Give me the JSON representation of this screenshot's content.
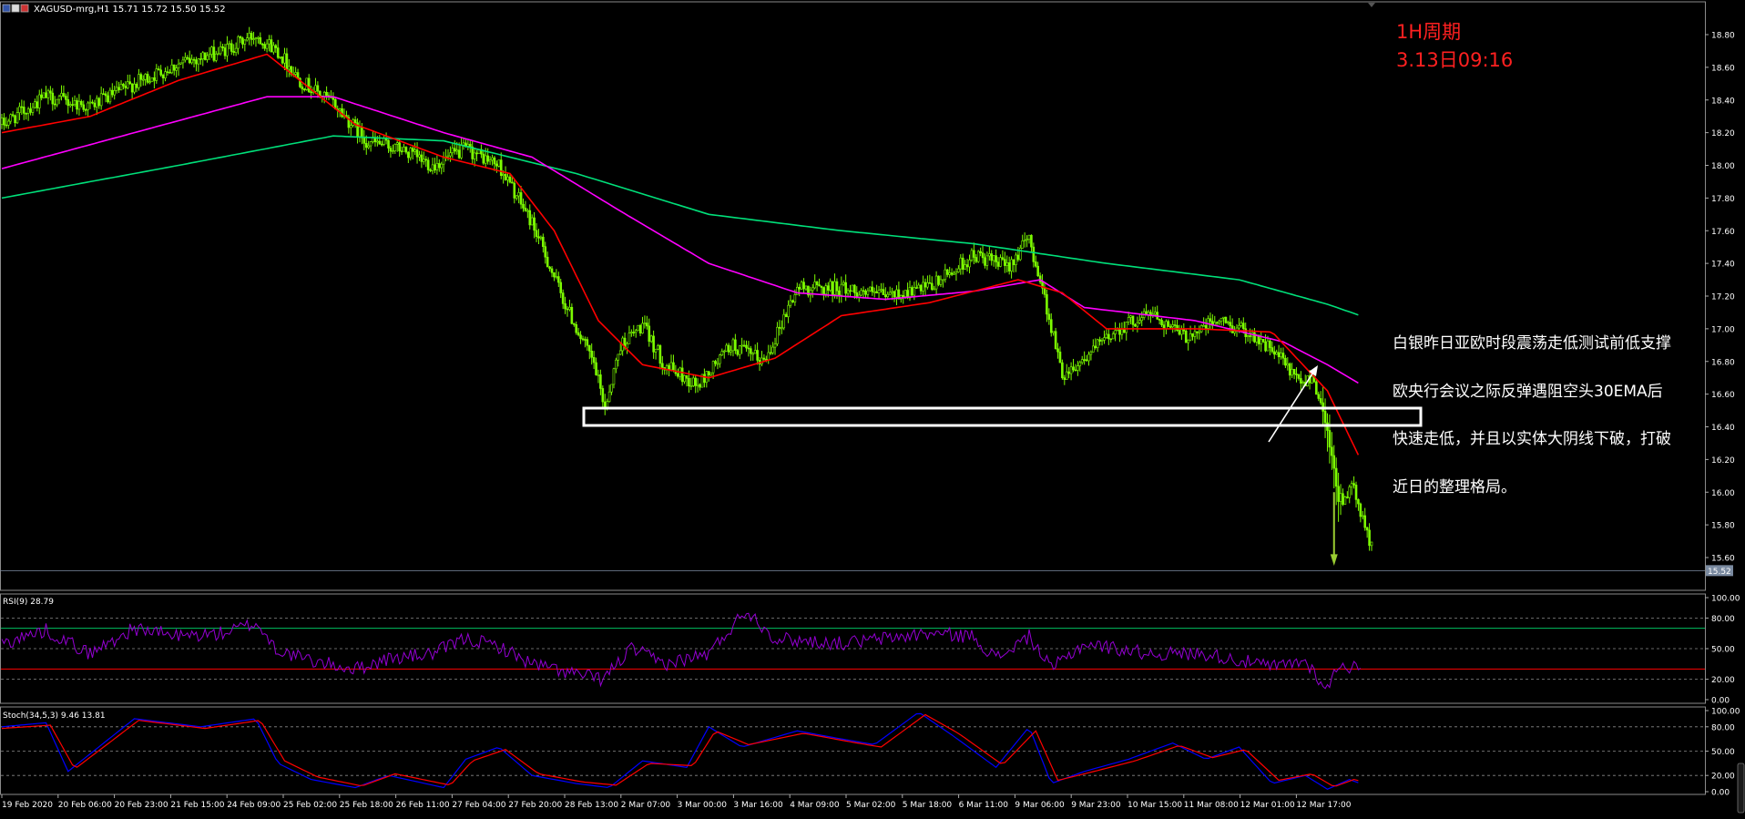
{
  "header": {
    "symbol_line": "XAGUSD-mrg,H1  15.71 15.72 15.50 15.52"
  },
  "annotations": {
    "period": "1H周期",
    "timestamp": "3.13日09:16",
    "commentary": [
      "白银昨日亚欧时段震荡走低测试前低支撑",
      "欧央行会议之际反弹遇阻空头30EMA后",
      "快速走低，并且以实体大阴线下破，打破",
      "近日的整理格局。"
    ]
  },
  "colors": {
    "background": "#000000",
    "candles": "#7CFC00",
    "ema_fast": "#FF0000",
    "ema_mid": "#FF00FF",
    "ema_slow": "#00E07A",
    "rsi_line": "#9400D3",
    "rsi_upper": "#00C060",
    "rsi_lower": "#FF0000",
    "stoch_main": "#0000FF",
    "stoch_signal": "#FF0000",
    "annotation_red": "#FF2020",
    "price_badge": "#7a8aa0"
  },
  "chart_data": [
    {
      "type": "candlestick",
      "symbol": "XAGUSD-mrg,H1",
      "ylim": [
        15.45,
        18.92
      ],
      "y_ticks": [
        "18.80",
        "18.60",
        "18.40",
        "18.20",
        "18.00",
        "17.80",
        "17.60",
        "17.40",
        "17.20",
        "17.00",
        "16.80",
        "16.60",
        "16.40",
        "16.20",
        "16.00",
        "15.80",
        "15.60"
      ],
      "current_price": "15.52",
      "x_ticks": [
        "19 Feb 2020",
        "20 Feb 06:00",
        "20 Feb 23:00",
        "21 Feb 15:00",
        "24 Feb 09:00",
        "25 Feb 02:00",
        "25 Feb 18:00",
        "26 Feb 11:00",
        "27 Feb 04:00",
        "27 Feb 20:00",
        "28 Feb 13:00",
        "2 Mar 07:00",
        "3 Mar 00:00",
        "3 Mar 16:00",
        "4 Mar 09:00",
        "5 Mar 02:00",
        "5 Mar 18:00",
        "6 Mar 11:00",
        "9 Mar 06:00",
        "9 Mar 23:00",
        "10 Mar 15:00",
        "11 Mar 08:00",
        "12 Mar 01:00",
        "12 Mar 17:00"
      ],
      "price_anchors": [
        [
          0,
          18.25
        ],
        [
          20,
          18.42
        ],
        [
          40,
          18.36
        ],
        [
          60,
          18.5
        ],
        [
          80,
          18.62
        ],
        [
          100,
          18.7
        ],
        [
          115,
          18.8
        ],
        [
          125,
          18.7
        ],
        [
          135,
          18.52
        ],
        [
          150,
          18.38
        ],
        [
          165,
          18.15
        ],
        [
          180,
          18.1
        ],
        [
          195,
          18.0
        ],
        [
          210,
          18.1
        ],
        [
          225,
          18.0
        ],
        [
          240,
          17.65
        ],
        [
          255,
          17.15
        ],
        [
          268,
          16.78
        ],
        [
          273,
          16.52
        ],
        [
          280,
          16.9
        ],
        [
          290,
          17.02
        ],
        [
          300,
          16.78
        ],
        [
          315,
          16.65
        ],
        [
          330,
          16.9
        ],
        [
          345,
          16.8
        ],
        [
          360,
          17.25
        ],
        [
          380,
          17.25
        ],
        [
          400,
          17.2
        ],
        [
          420,
          17.25
        ],
        [
          440,
          17.45
        ],
        [
          455,
          17.38
        ],
        [
          465,
          17.55
        ],
        [
          470,
          17.3
        ],
        [
          480,
          16.72
        ],
        [
          490,
          16.82
        ],
        [
          505,
          17.0
        ],
        [
          520,
          17.1
        ],
        [
          535,
          16.95
        ],
        [
          550,
          17.05
        ],
        [
          565,
          16.98
        ],
        [
          578,
          16.83
        ],
        [
          588,
          16.65
        ],
        [
          593,
          16.72
        ],
        [
          600,
          16.4
        ],
        [
          605,
          15.95
        ],
        [
          612,
          16.02
        ],
        [
          620,
          15.65
        ]
      ],
      "ema_fast_anchors": [
        [
          0,
          18.2
        ],
        [
          40,
          18.3
        ],
        [
          80,
          18.52
        ],
        [
          120,
          18.68
        ],
        [
          160,
          18.25
        ],
        [
          200,
          18.05
        ],
        [
          230,
          17.95
        ],
        [
          250,
          17.6
        ],
        [
          270,
          17.05
        ],
        [
          290,
          16.78
        ],
        [
          320,
          16.7
        ],
        [
          350,
          16.82
        ],
        [
          380,
          17.08
        ],
        [
          420,
          17.16
        ],
        [
          460,
          17.3
        ],
        [
          480,
          17.22
        ],
        [
          500,
          17.0
        ],
        [
          540,
          17.0
        ],
        [
          575,
          16.98
        ],
        [
          600,
          16.62
        ],
        [
          615,
          16.2
        ]
      ],
      "ema_mid_anchors": [
        [
          0,
          17.98
        ],
        [
          60,
          18.2
        ],
        [
          120,
          18.42
        ],
        [
          150,
          18.42
        ],
        [
          200,
          18.2
        ],
        [
          240,
          18.05
        ],
        [
          280,
          17.72
        ],
        [
          320,
          17.4
        ],
        [
          360,
          17.22
        ],
        [
          400,
          17.18
        ],
        [
          440,
          17.23
        ],
        [
          470,
          17.3
        ],
        [
          490,
          17.13
        ],
        [
          540,
          17.05
        ],
        [
          580,
          16.92
        ],
        [
          600,
          16.78
        ],
        [
          615,
          16.66
        ]
      ],
      "ema_slow_anchors": [
        [
          0,
          17.8
        ],
        [
          80,
          18.0
        ],
        [
          150,
          18.18
        ],
        [
          200,
          18.15
        ],
        [
          260,
          17.95
        ],
        [
          320,
          17.7
        ],
        [
          380,
          17.6
        ],
        [
          440,
          17.52
        ],
        [
          500,
          17.4
        ],
        [
          560,
          17.3
        ],
        [
          600,
          17.15
        ],
        [
          615,
          17.08
        ]
      ]
    },
    {
      "type": "line",
      "label": "RSI(9) 28.79",
      "ylim": [
        0,
        100
      ],
      "y_ticks": [
        "100.00",
        "80.00",
        "50.00",
        "20.00",
        "0.00"
      ],
      "levels": [
        70,
        30
      ],
      "series_anchors": [
        [
          0,
          55
        ],
        [
          20,
          68
        ],
        [
          40,
          45
        ],
        [
          60,
          70
        ],
        [
          80,
          62
        ],
        [
          100,
          65
        ],
        [
          115,
          75
        ],
        [
          125,
          48
        ],
        [
          140,
          38
        ],
        [
          160,
          30
        ],
        [
          175,
          40
        ],
        [
          195,
          45
        ],
        [
          210,
          60
        ],
        [
          225,
          52
        ],
        [
          240,
          35
        ],
        [
          260,
          25
        ],
        [
          272,
          20
        ],
        [
          285,
          50
        ],
        [
          300,
          35
        ],
        [
          320,
          45
        ],
        [
          337,
          88
        ],
        [
          350,
          60
        ],
        [
          380,
          55
        ],
        [
          420,
          65
        ],
        [
          440,
          62
        ],
        [
          450,
          40
        ],
        [
          465,
          62
        ],
        [
          475,
          30
        ],
        [
          490,
          55
        ],
        [
          520,
          45
        ],
        [
          545,
          45
        ],
        [
          575,
          32
        ],
        [
          590,
          38
        ],
        [
          600,
          10
        ],
        [
          605,
          35
        ],
        [
          615,
          30
        ]
      ]
    },
    {
      "type": "line",
      "label": "Stoch(34,5,3) 9.46 13.81",
      "ylim": [
        0,
        100
      ],
      "y_ticks": [
        "100.00",
        "80.00",
        "50.00",
        "20.00",
        "0.00"
      ],
      "series": [
        {
          "name": "main",
          "anchors": [
            [
              0,
              80
            ],
            [
              20,
              85
            ],
            [
              30,
              25
            ],
            [
              60,
              90
            ],
            [
              90,
              80
            ],
            [
              115,
              90
            ],
            [
              125,
              35
            ],
            [
              140,
              15
            ],
            [
              160,
              5
            ],
            [
              175,
              20
            ],
            [
              200,
              5
            ],
            [
              210,
              40
            ],
            [
              225,
              55
            ],
            [
              240,
              20
            ],
            [
              260,
              10
            ],
            [
              275,
              5
            ],
            [
              290,
              38
            ],
            [
              310,
              30
            ],
            [
              320,
              80
            ],
            [
              335,
              55
            ],
            [
              360,
              75
            ],
            [
              380,
              65
            ],
            [
              395,
              58
            ],
            [
              415,
              98
            ],
            [
              430,
              70
            ],
            [
              450,
              30
            ],
            [
              465,
              80
            ],
            [
              475,
              10
            ],
            [
              490,
              25
            ],
            [
              510,
              40
            ],
            [
              530,
              60
            ],
            [
              545,
              40
            ],
            [
              560,
              55
            ],
            [
              575,
              10
            ],
            [
              590,
              20
            ],
            [
              600,
              3
            ],
            [
              610,
              15
            ],
            [
              615,
              10
            ]
          ]
        },
        {
          "name": "signal",
          "anchors": [
            [
              0,
              78
            ],
            [
              22,
              82
            ],
            [
              33,
              28
            ],
            [
              62,
              88
            ],
            [
              92,
              78
            ],
            [
              117,
              88
            ],
            [
              128,
              38
            ],
            [
              143,
              18
            ],
            [
              163,
              7
            ],
            [
              178,
              22
            ],
            [
              203,
              8
            ],
            [
              213,
              38
            ],
            [
              228,
              52
            ],
            [
              243,
              22
            ],
            [
              263,
              12
            ],
            [
              278,
              8
            ],
            [
              293,
              35
            ],
            [
              313,
              32
            ],
            [
              323,
              75
            ],
            [
              338,
              58
            ],
            [
              363,
              72
            ],
            [
              383,
              62
            ],
            [
              398,
              55
            ],
            [
              418,
              95
            ],
            [
              433,
              72
            ],
            [
              453,
              33
            ],
            [
              468,
              75
            ],
            [
              478,
              14
            ],
            [
              493,
              24
            ],
            [
              513,
              38
            ],
            [
              533,
              57
            ],
            [
              548,
              42
            ],
            [
              563,
              52
            ],
            [
              578,
              14
            ],
            [
              593,
              22
            ],
            [
              603,
              6
            ],
            [
              612,
              15
            ],
            [
              615,
              13
            ]
          ]
        }
      ]
    }
  ]
}
